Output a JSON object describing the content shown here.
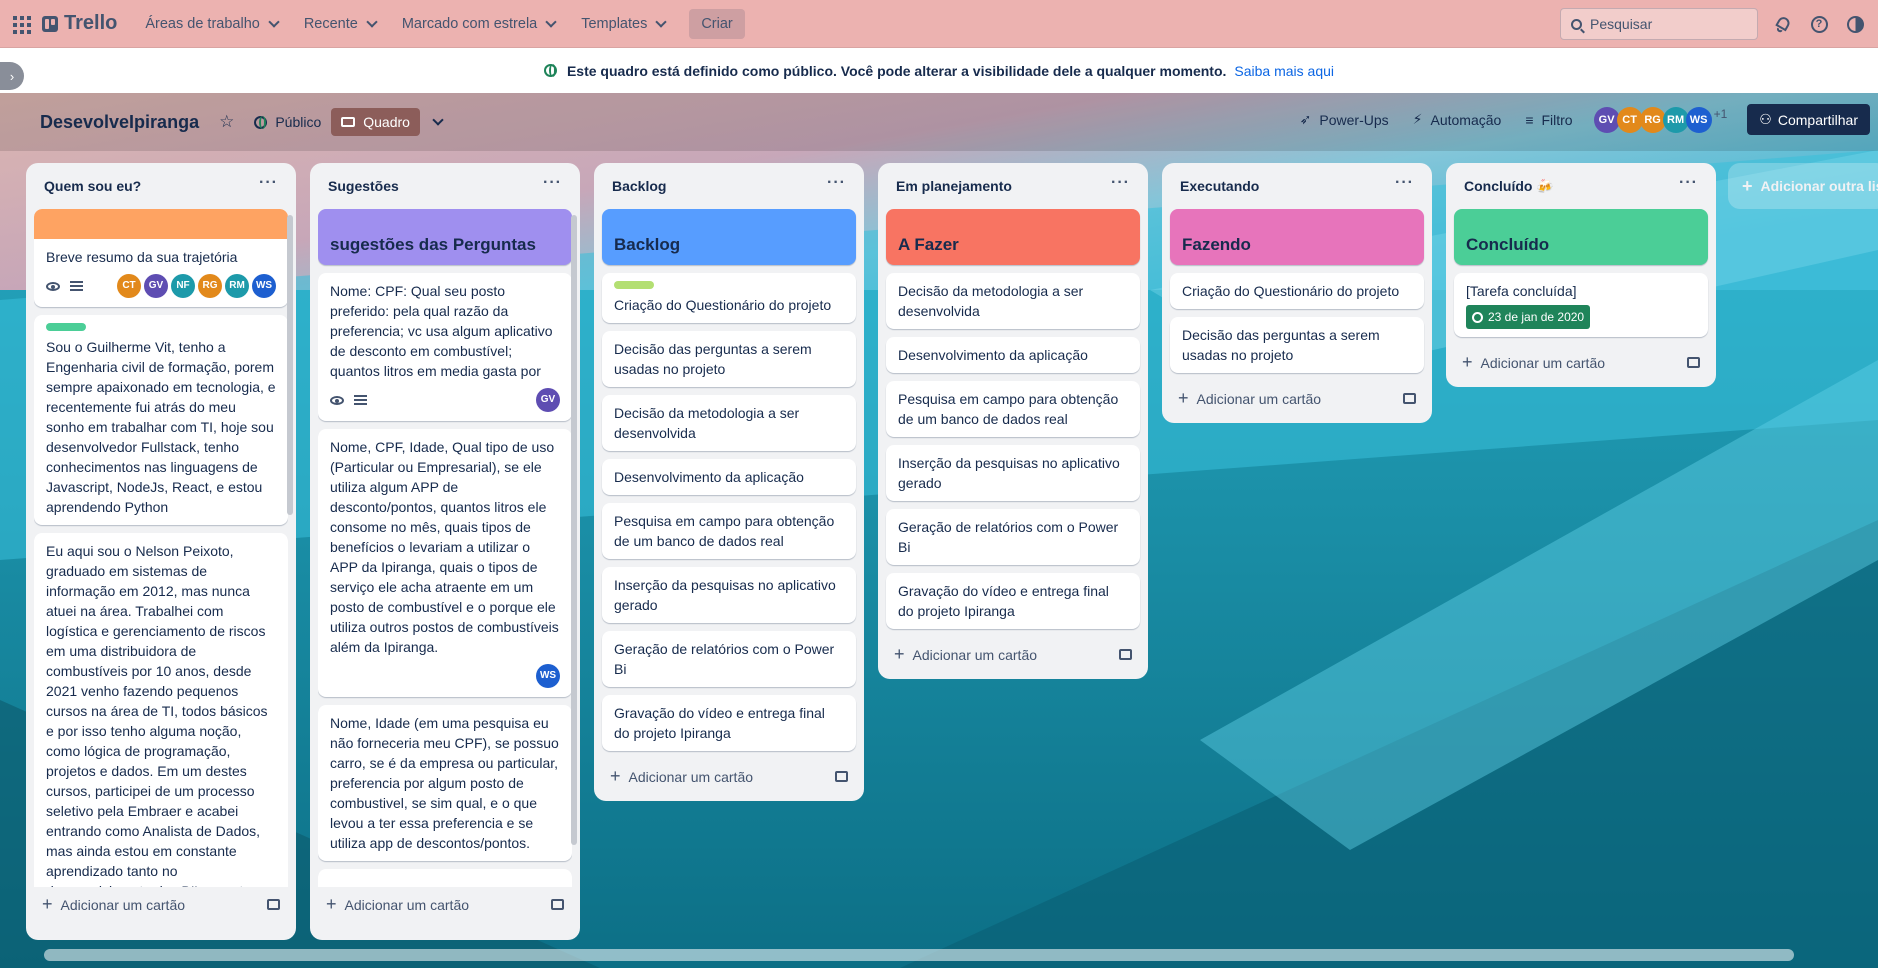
{
  "topnav": {
    "logo": "Trello",
    "menu": [
      {
        "label": "Áreas de trabalho"
      },
      {
        "label": "Recente"
      },
      {
        "label": "Marcado com estrela"
      },
      {
        "label": "Templates"
      }
    ],
    "create": "Criar",
    "search_placeholder": "Pesquisar"
  },
  "banner": {
    "message": "Este quadro está definido como público. Você pode alterar a visibilidade dele a qualquer momento.",
    "link": "Saiba mais aqui"
  },
  "board": {
    "title": "DesevolveIpiranga",
    "visibility": "Público",
    "view": "Quadro",
    "powerups": "Power-Ups",
    "automation": "Automação",
    "filter": "Filtro",
    "members_more": "+1",
    "share": "Compartilhar",
    "members": [
      {
        "initials": "GV",
        "color": "#5e4db2"
      },
      {
        "initials": "CT",
        "color": "#e2891b"
      },
      {
        "initials": "RG",
        "color": "#e2891b"
      },
      {
        "initials": "RM",
        "color": "#1d9aaa"
      },
      {
        "initials": "WS",
        "color": "#1d5fd0"
      }
    ]
  },
  "lists": {
    "l1": {
      "title": "Quem sou eu?",
      "c1": "Breve resumo da sua trajetória",
      "c1_members": [
        {
          "initials": "CT",
          "color": "#e2891b"
        },
        {
          "initials": "GV",
          "color": "#5e4db2"
        },
        {
          "initials": "NF",
          "color": "#1d9aaa"
        },
        {
          "initials": "RG",
          "color": "#e2891b"
        },
        {
          "initials": "RM",
          "color": "#1d9aaa"
        },
        {
          "initials": "WS",
          "color": "#1d5fd0"
        }
      ],
      "c2": "Sou o Guilherme Vit, tenho a Engenharia civil de formação, porem sempre apaixonado em tecnologia, e recentemente fui atrás do meu sonho em trabalhar com TI, hoje sou desenvolvedor Fullstack, tenho conhecimentos nas linguagens de Javascript, NodeJs, React, e estou aprendendo Python",
      "c3": "Eu aqui sou o Nelson Peixoto, graduado em sistemas de informação em 2012, mas nunca atuei na área. Trabalhei com logística e gerenciamento de riscos em uma distribuidora de combustíveis por 10 anos, desde 2021 venho fazendo pequenos cursos na área de TI, todos básicos e por isso tenho alguma noção, como lógica de programação, projetos e dados. Em um destes cursos, participei de um processo seletivo pela Embraer e acabei entrando como Analista de Dados, mas ainda estou em constante aprendizado tanto no desenvolvimento dos BI's quanto nos processos da Embraer que são",
      "add": "Adicionar um cartão"
    },
    "l2": {
      "title": "Sugestões",
      "head": "sugestões das Perguntas",
      "c1": "Nome: CPF: Qual seu posto preferido: pela qual razão da preferencia; vc usa algum aplicativo de desconto em combustível; quantos litros em media gasta por mês; que tipo de motorista você é",
      "c1_member": {
        "initials": "GV",
        "color": "#5e4db2"
      },
      "c2": "Nome, CPF, Idade, Qual tipo de uso (Particular ou Empresarial), se ele utiliza algum APP de desconto/pontos, quantos litros ele consome no mês, quais tipos de benefícios o levariam a utilizar o APP da Ipiranga, quais o tipos de serviço ele acha atraente em um posto de combustível e o porque ele utiliza outros postos de combustíveis além da Ipiranga.",
      "c2_member": {
        "initials": "WS",
        "color": "#1d5fd0"
      },
      "c3": "Nome, Idade (em uma pesquisa eu não forneceria meu CPF), se possuo carro, se é da empresa ou particular, preferencia por algum posto de combustivel, se sim qual, e o que levou a ter essa preferencia e se utiliza app de descontos/pontos.",
      "add": "Adicionar um cartão"
    },
    "l3": {
      "title": "Backlog",
      "head": "Backlog",
      "cards": [
        "Criação do Questionário do projeto",
        "Decisão das perguntas a serem usadas no projeto",
        "Decisão da metodologia a ser desenvolvida",
        "Desenvolvimento da aplicação",
        "Pesquisa em campo para obtenção de um banco de dados real",
        "Inserção da pesquisas no aplicativo gerado",
        "Geração de relatórios com o Power Bi",
        "Gravação do vídeo e entrega final do projeto Ipiranga"
      ],
      "add": "Adicionar um cartão"
    },
    "l4": {
      "title": "Em planejamento",
      "head": "A Fazer",
      "cards": [
        "Decisão da metodologia a ser desenvolvida",
        "Desenvolvimento da aplicação",
        "Pesquisa em campo para obtenção de um banco de dados real",
        "Inserção da pesquisas no aplicativo gerado",
        "Geração de relatórios com o Power Bi",
        "Gravação do vídeo e entrega final do projeto Ipiranga"
      ],
      "add": "Adicionar um cartão"
    },
    "l5": {
      "title": "Executando",
      "head": "Fazendo",
      "cards": [
        "Criação do Questionário do projeto",
        "Decisão das perguntas a serem usadas no projeto"
      ],
      "add": "Adicionar um cartão"
    },
    "l6": {
      "title": "Concluído 🍻",
      "head": "Concluído",
      "c1": "[Tarefa concluída]",
      "c1_date": "23 de jan de 2020",
      "add": "Adicionar um cartão"
    },
    "add_list": "Adicionar outra lista"
  },
  "colors": {
    "orange_cover": "#fea362",
    "purple_cover": "#9f8fef",
    "blue_cover": "#579dff",
    "red_cover": "#f87462",
    "pink_cover": "#e774bb",
    "green_cover": "#4bce97",
    "green_label": "#4bce97",
    "lime_label": "#b3df72"
  }
}
